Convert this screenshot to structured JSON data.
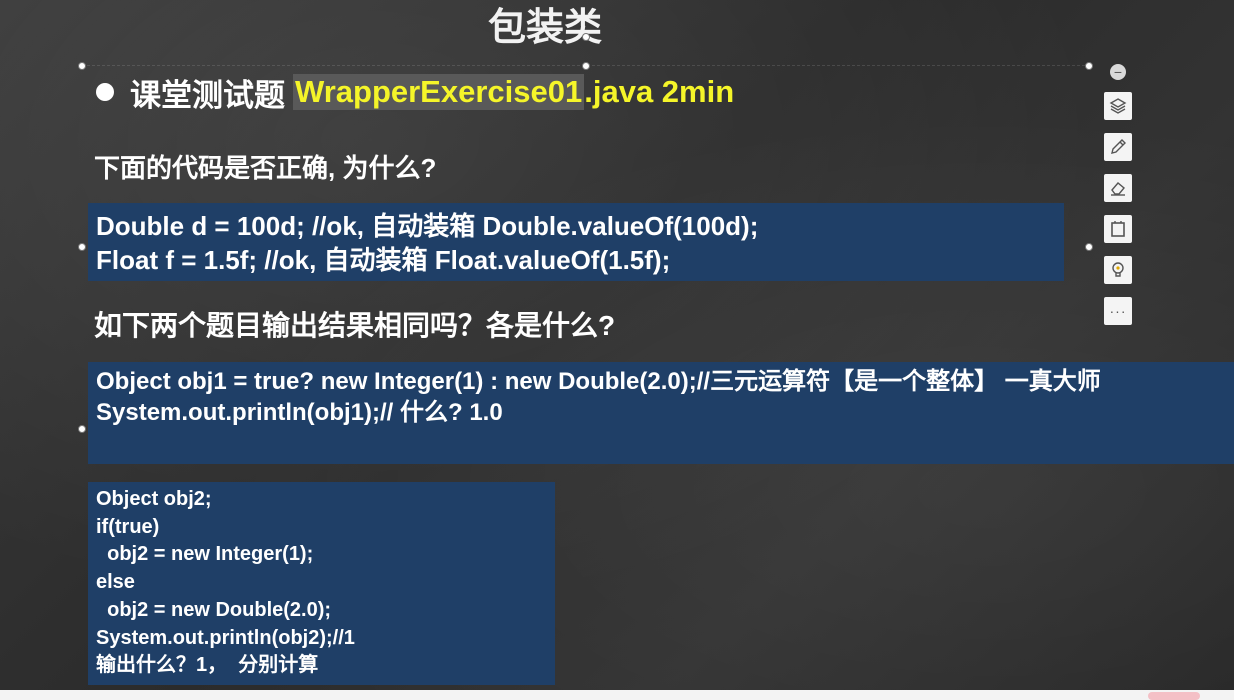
{
  "slide": {
    "title": "包装类",
    "bullet": {
      "prefix": "课堂测试题",
      "file": "WrapperExercise01",
      "rest": ".java 2min"
    },
    "question1": "下面的代码是否正确, 为什么?",
    "box1_lines": [
      "Double d = 100d; //ok, 自动装箱 Double.valueOf(100d);",
      "Float f = 1.5f; //ok, 自动装箱 Float.valueOf(1.5f);"
    ],
    "question2": "如下两个题目输出结果相同吗？各是什么?",
    "box2_lines": [
      "Object obj1 = true? new Integer(1) : new Double(2.0);//三元运算符【是一个整体】 一真大师",
      "System.out.println(obj1);// 什么? 1.0"
    ],
    "box3_lines": [
      "Object obj2;",
      "if(true)",
      "  obj2 = new Integer(1);",
      "else",
      "  obj2 = new Double(2.0);",
      "System.out.println(obj2);//1",
      "输出什么？1，  分别计算"
    ]
  },
  "toolbar": {
    "collapse": "−",
    "more": "···",
    "icons": [
      "layers-icon",
      "pen-icon",
      "eraser-icon",
      "frame-icon",
      "lightbulb-icon"
    ]
  },
  "colors": {
    "box_bg": "#1f3f67",
    "highlight": "#f5f529",
    "file_bg": "#595959",
    "text": "#ffffff"
  }
}
